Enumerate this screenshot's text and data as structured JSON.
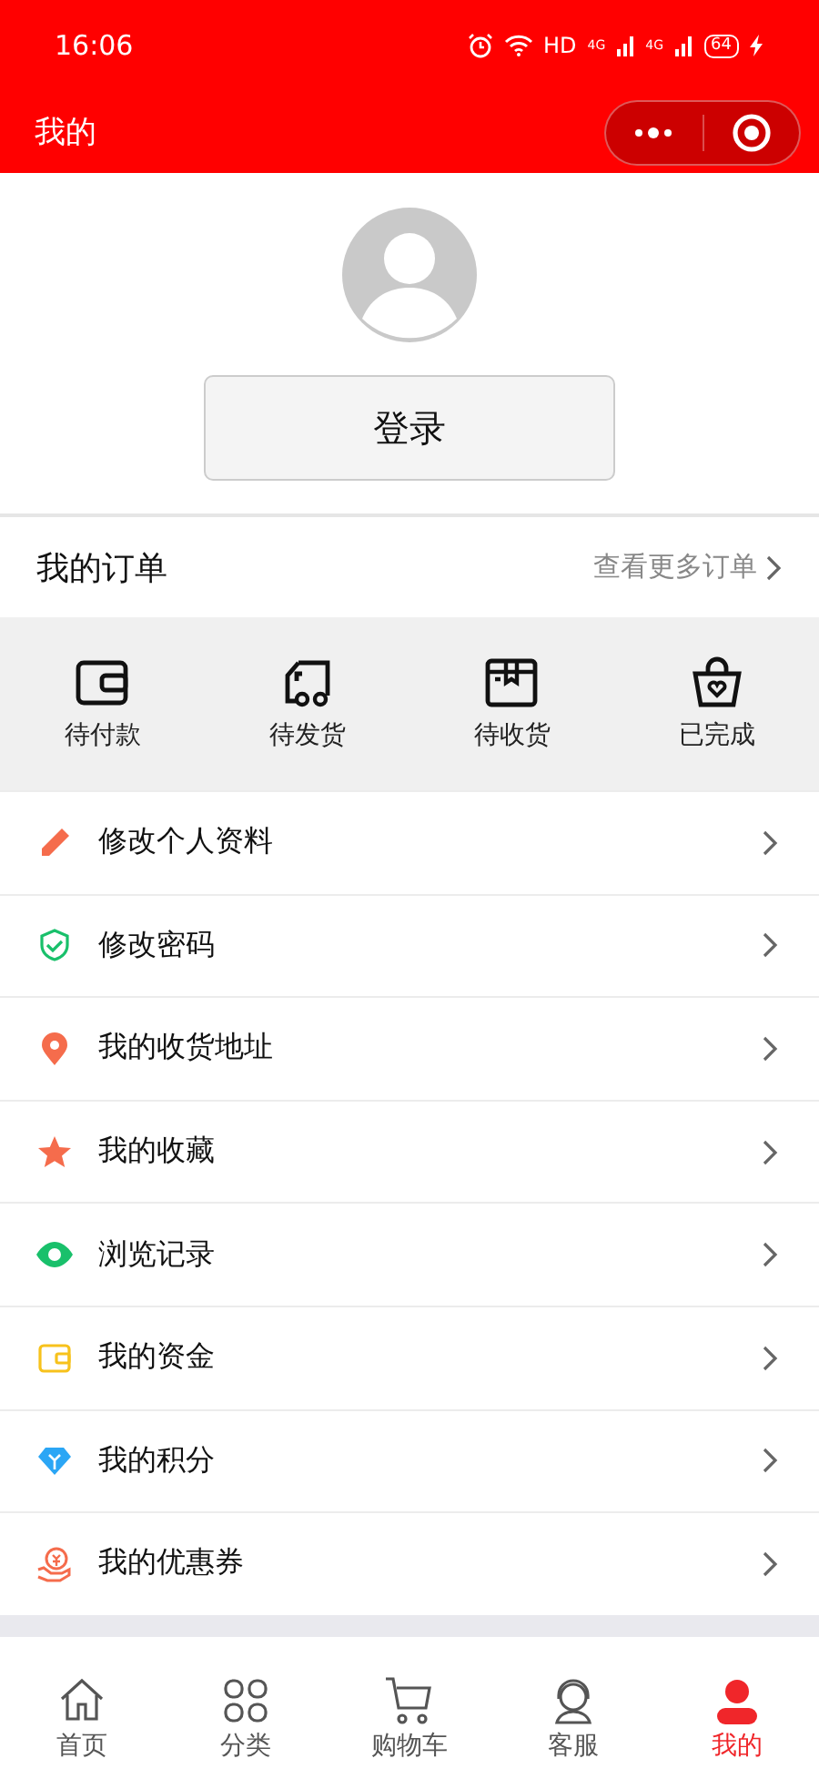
{
  "status_bar": {
    "time": "16:06",
    "network": "HD",
    "signal_labels": [
      "4G",
      "4G"
    ],
    "battery": "64"
  },
  "header": {
    "title": "我的"
  },
  "profile": {
    "login_button": "登录"
  },
  "orders": {
    "title": "我的订单",
    "more_link": "查看更多订单",
    "items": [
      {
        "kind": "wallet",
        "label": "待付款"
      },
      {
        "kind": "truck",
        "label": "待发货"
      },
      {
        "kind": "box",
        "label": "待收货"
      },
      {
        "kind": "bag",
        "label": "已完成"
      }
    ]
  },
  "menu": [
    {
      "kind": "pencil",
      "label": "修改个人资料",
      "color": "#f56c4c"
    },
    {
      "kind": "shield",
      "label": "修改密码",
      "color": "#19c06b"
    },
    {
      "kind": "pin",
      "label": "我的收货地址",
      "color": "#f56c4c"
    },
    {
      "kind": "star",
      "label": "我的收藏",
      "color": "#f56c4c"
    },
    {
      "kind": "eye",
      "label": "浏览记录",
      "color": "#19c06b"
    },
    {
      "kind": "wallet",
      "label": "我的资金",
      "color": "#f7c21c"
    },
    {
      "kind": "diamond",
      "label": "我的积分",
      "color": "#2ba6f5"
    },
    {
      "kind": "coupon",
      "label": "我的优惠券",
      "color": "#f56c4c"
    }
  ],
  "tab_bar": [
    {
      "kind": "home",
      "label": "首页",
      "selected": false
    },
    {
      "kind": "grid",
      "label": "分类",
      "selected": false
    },
    {
      "kind": "cart",
      "label": "购物车",
      "selected": false
    },
    {
      "kind": "headset",
      "label": "客服",
      "selected": false
    },
    {
      "kind": "person",
      "label": "我的",
      "selected": true
    }
  ]
}
